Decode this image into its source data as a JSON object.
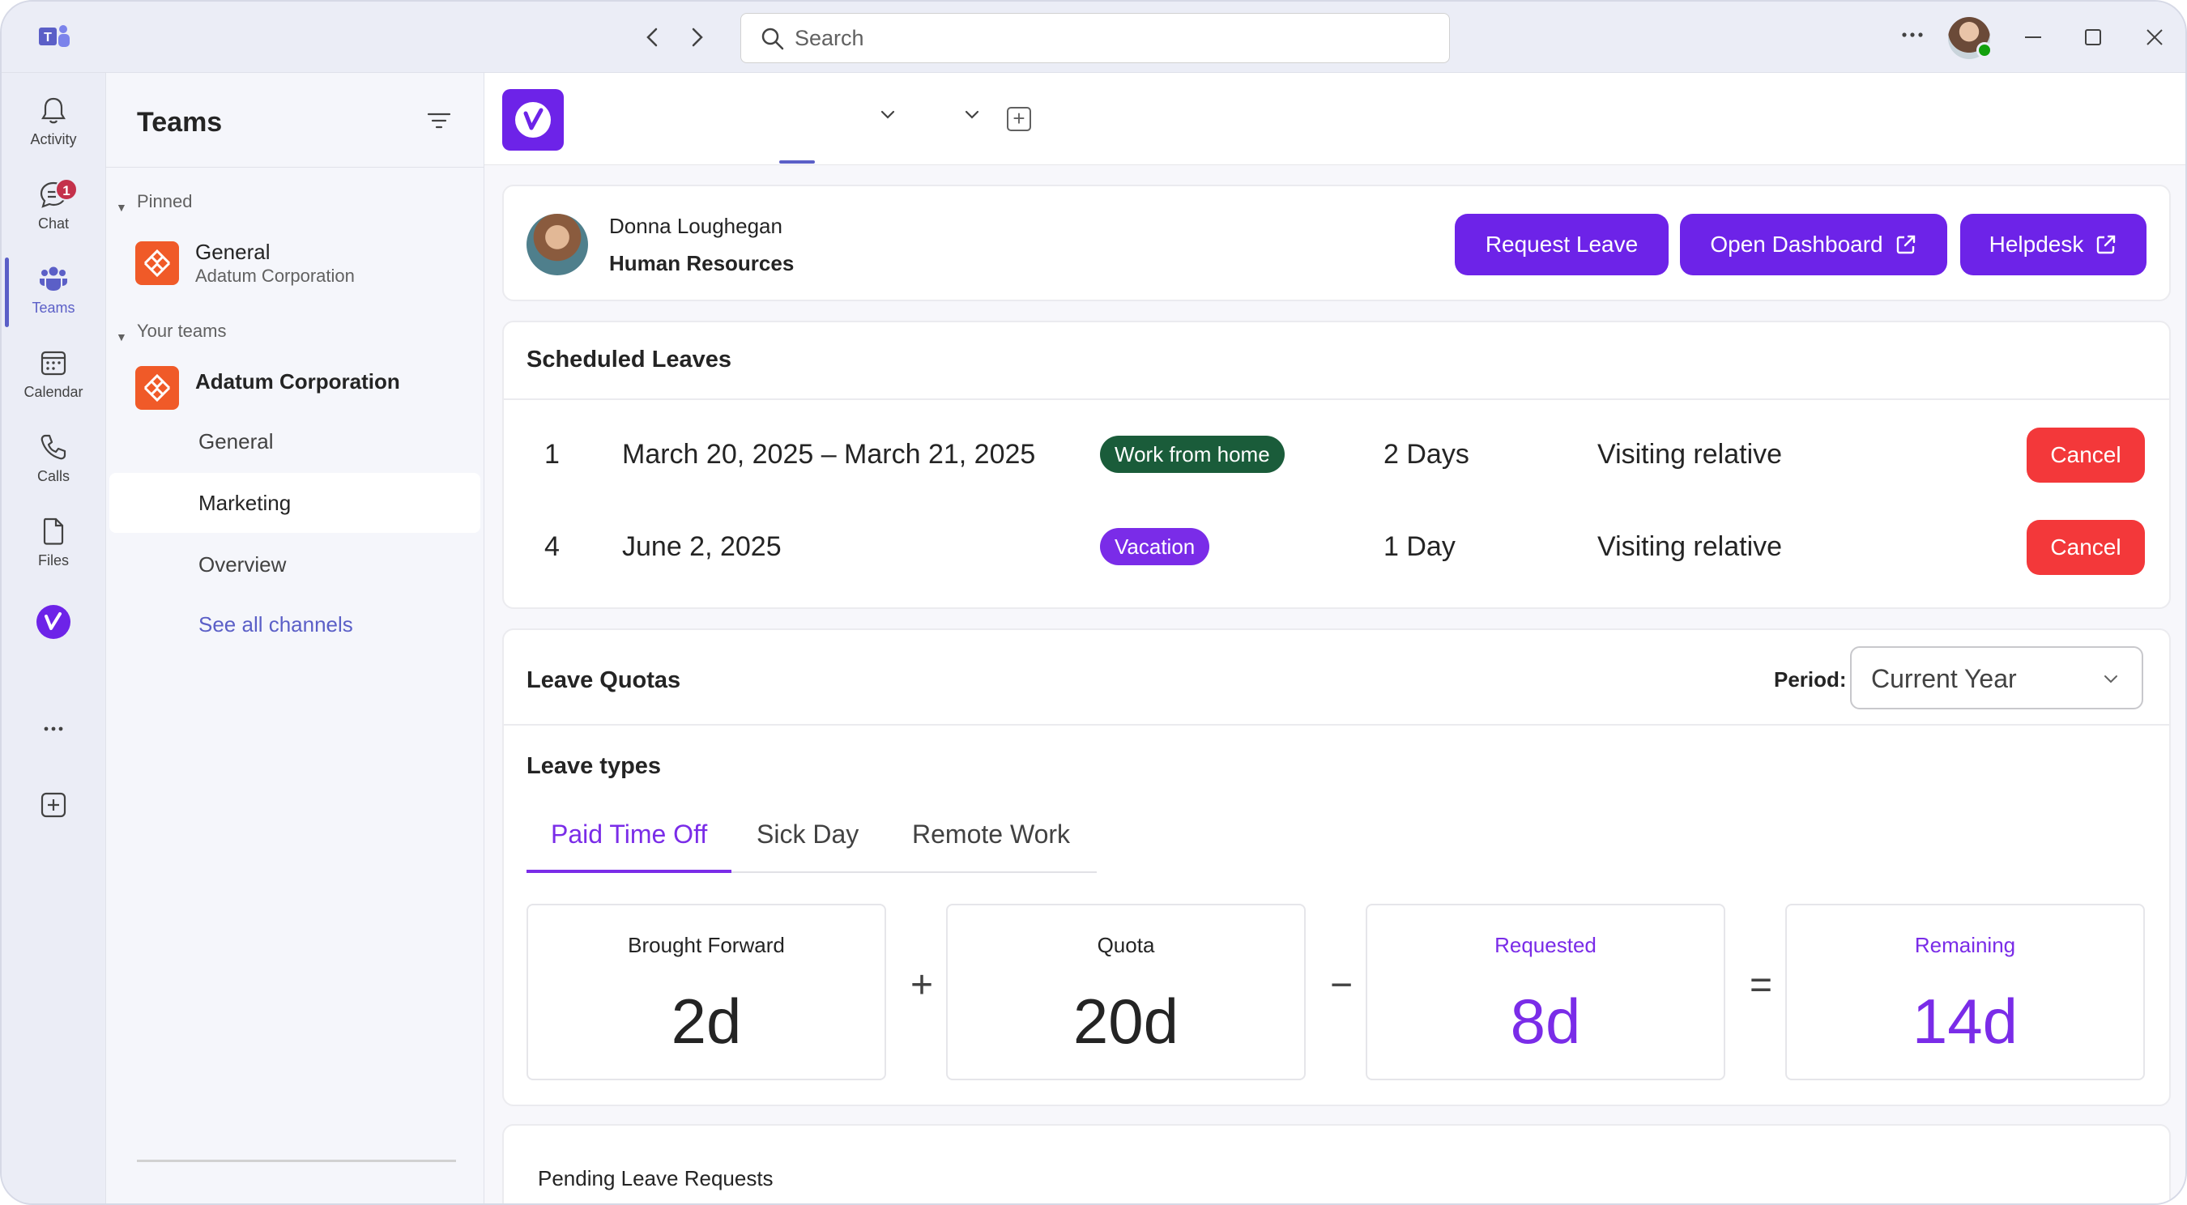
{
  "titlebar": {
    "search_placeholder": "Search",
    "back_icon": "chevron-left-icon",
    "forward_icon": "chevron-right-icon",
    "more_icon": "ellipsis-icon",
    "minimize_icon": "minimize-icon",
    "maximize_icon": "maximize-icon",
    "close_icon": "close-icon"
  },
  "rail": {
    "items": [
      {
        "label": "Activity",
        "icon": "bell-icon"
      },
      {
        "label": "Chat",
        "icon": "chat-icon",
        "badge": "1"
      },
      {
        "label": "Teams",
        "icon": "teams-icon",
        "active": true
      },
      {
        "label": "Calendar",
        "icon": "calendar-icon"
      },
      {
        "label": "Calls",
        "icon": "phone-icon"
      },
      {
        "label": "Files",
        "icon": "file-icon"
      }
    ]
  },
  "teams_pane": {
    "title": "Teams",
    "pinned_label": "Pinned",
    "pinned_team": {
      "name": "General",
      "sub": "Adatum Corporation"
    },
    "your_teams_label": "Your teams",
    "team": {
      "name": "Adatum Corporation"
    },
    "channels": [
      "General",
      "Marketing",
      "Overview"
    ],
    "selected_channel": "Marketing",
    "see_all": "See all channels"
  },
  "profile": {
    "name": "Donna Loughegan",
    "department": "Human Resources",
    "buttons": {
      "request_leave": "Request Leave",
      "open_dashboard": "Open Dashboard",
      "helpdesk": "Helpdesk"
    }
  },
  "scheduled_leaves": {
    "title": "Scheduled Leaves",
    "cancel_label": "Cancel",
    "rows": [
      {
        "num": "1",
        "dates": "March 20, 2025 – March 21, 2025",
        "type": "Work from home",
        "type_color": "#1a5c3a",
        "days": "2 Days",
        "reason": "Visiting relative"
      },
      {
        "num": "4",
        "dates": "June 2, 2025",
        "type": "Vacation",
        "type_color": "#7a2ce8",
        "days": "1 Day",
        "reason": "Visiting relative"
      }
    ]
  },
  "leave_quotas": {
    "title": "Leave Quotas",
    "period_label": "Period:",
    "period_value": "Current Year",
    "leave_types_title": "Leave types",
    "tabs": [
      "Paid Time Off",
      "Sick Day",
      "Remote Work"
    ],
    "active_tab": "Paid Time Off",
    "boxes": [
      {
        "label": "Brought Forward",
        "value": "2d"
      },
      {
        "label": "Quota",
        "value": "20d"
      },
      {
        "label": "Requested",
        "value": "8d"
      },
      {
        "label": "Remaining",
        "value": "14d"
      }
    ],
    "operators": [
      "+",
      "−",
      "="
    ]
  },
  "pending": {
    "title": "Pending Leave Requests"
  },
  "colors": {
    "accent": "#7a2ce8",
    "brand_purple": "#6d23e8",
    "teams_purple": "#5b5fc7",
    "cancel_red": "#f3383a",
    "team_tile_orange": "#f05a28"
  }
}
